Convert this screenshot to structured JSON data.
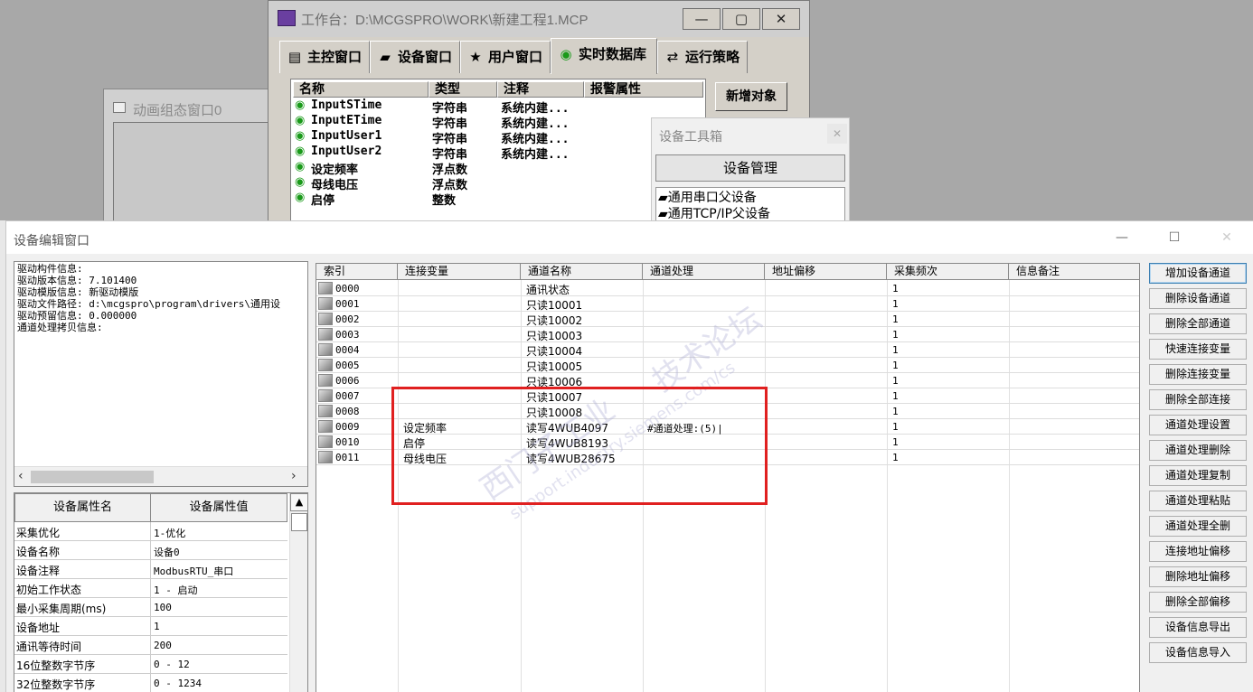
{
  "workbench": {
    "title": "工作台：D:\\MCGSPRO\\WORK\\新建工程1.MCP",
    "buttons": {
      "minimize": "—",
      "maximize": "▢",
      "close": "✕"
    },
    "tabs": [
      {
        "label": "主控窗口",
        "icon": "window-icon"
      },
      {
        "label": "设备窗口",
        "icon": "device-icon"
      },
      {
        "label": "用户窗口",
        "icon": "user-window-icon"
      },
      {
        "label": "实时数据库",
        "icon": "database-icon"
      },
      {
        "label": "运行策略",
        "icon": "strategy-icon"
      }
    ],
    "db_headers": [
      "名称",
      "类型",
      "注释",
      "报警属性"
    ],
    "db_rows": [
      {
        "name": "InputSTime",
        "type": "字符串",
        "note": "系统内建..."
      },
      {
        "name": "InputETime",
        "type": "字符串",
        "note": "系统内建..."
      },
      {
        "name": "InputUser1",
        "type": "字符串",
        "note": "系统内建..."
      },
      {
        "name": "InputUser2",
        "type": "字符串",
        "note": "系统内建..."
      },
      {
        "name": "设定频率",
        "type": "浮点数",
        "note": ""
      },
      {
        "name": "母线电压",
        "type": "浮点数",
        "note": ""
      },
      {
        "name": "启停",
        "type": "整数",
        "note": ""
      }
    ],
    "add_object": "新增对象"
  },
  "animation_window": {
    "title": "动画组态窗口0"
  },
  "toolbox": {
    "title": "设备工具箱",
    "close": "✕",
    "device_manager": "设备管理",
    "items": [
      "通用串口父设备",
      "通用TCP/IP父设备"
    ]
  },
  "editor": {
    "title": "设备编辑窗口",
    "window_controls": {
      "minimize": "—",
      "maximize": "☐",
      "close": "✕"
    },
    "driver_info": [
      "驱动构件信息:",
      "驱动版本信息: 7.101400",
      "驱动模版信息: 新驱动模版",
      "驱动文件路径: d:\\mcgspro\\program\\drivers\\通用设",
      "驱动预留信息: 0.000000",
      "通道处理拷贝信息:"
    ],
    "props_headers": [
      "设备属性名",
      "设备属性值"
    ],
    "props": [
      {
        "name": "采集优化",
        "value": "1-优化"
      },
      {
        "name": "设备名称",
        "value": "设备0"
      },
      {
        "name": "设备注释",
        "value": "ModbusRTU_串口"
      },
      {
        "name": "初始工作状态",
        "value": "1 - 启动"
      },
      {
        "name": "最小采集周期(ms)",
        "value": "100"
      },
      {
        "name": "设备地址",
        "value": "1"
      },
      {
        "name": "通讯等待时间",
        "value": "200"
      },
      {
        "name": "16位整数字节序",
        "value": "0 - 12"
      },
      {
        "name": "32位整数字节序",
        "value": "0 - 1234"
      }
    ],
    "channel_headers": [
      "索引",
      "连接变量",
      "通道名称",
      "通道处理",
      "地址偏移",
      "采集频次",
      "信息备注"
    ],
    "channels": [
      {
        "index": "0000",
        "var": "",
        "name": "通讯状态",
        "proc": "",
        "freq": "1"
      },
      {
        "index": "0001",
        "var": "",
        "name": "只读10001",
        "proc": "",
        "freq": "1"
      },
      {
        "index": "0002",
        "var": "",
        "name": "只读10002",
        "proc": "",
        "freq": "1"
      },
      {
        "index": "0003",
        "var": "",
        "name": "只读10003",
        "proc": "",
        "freq": "1"
      },
      {
        "index": "0004",
        "var": "",
        "name": "只读10004",
        "proc": "",
        "freq": "1"
      },
      {
        "index": "0005",
        "var": "",
        "name": "只读10005",
        "proc": "",
        "freq": "1"
      },
      {
        "index": "0006",
        "var": "",
        "name": "只读10006",
        "proc": "",
        "freq": "1"
      },
      {
        "index": "0007",
        "var": "",
        "name": "只读10007",
        "proc": "",
        "freq": "1"
      },
      {
        "index": "0008",
        "var": "",
        "name": "只读10008",
        "proc": "",
        "freq": "1"
      },
      {
        "index": "0009",
        "var": "设定频率",
        "name": "读写4WUB4097",
        "proc": "#通道处理:(5)|",
        "freq": "1"
      },
      {
        "index": "0010",
        "var": "启停",
        "name": "读写4WUB8193",
        "proc": "",
        "freq": "1"
      },
      {
        "index": "0011",
        "var": "母线电压",
        "name": "读写4WUB28675",
        "proc": "",
        "freq": "1"
      }
    ],
    "side_buttons": [
      "增加设备通道",
      "删除设备通道",
      "删除全部通道",
      "快速连接变量",
      "删除连接变量",
      "删除全部连接",
      "通道处理设置",
      "通道处理删除",
      "通道处理复制",
      "通道处理粘贴",
      "通道处理全删",
      "连接地址偏移",
      "删除地址偏移",
      "删除全部偏移",
      "设备信息导出",
      "设备信息导入"
    ],
    "watermark": [
      "西门子工业",
      "技术论坛",
      "support.industry.siemens.com/cs"
    ]
  },
  "colors": {
    "highlight": "#e02020",
    "window_gray": "#d4d0c8"
  }
}
